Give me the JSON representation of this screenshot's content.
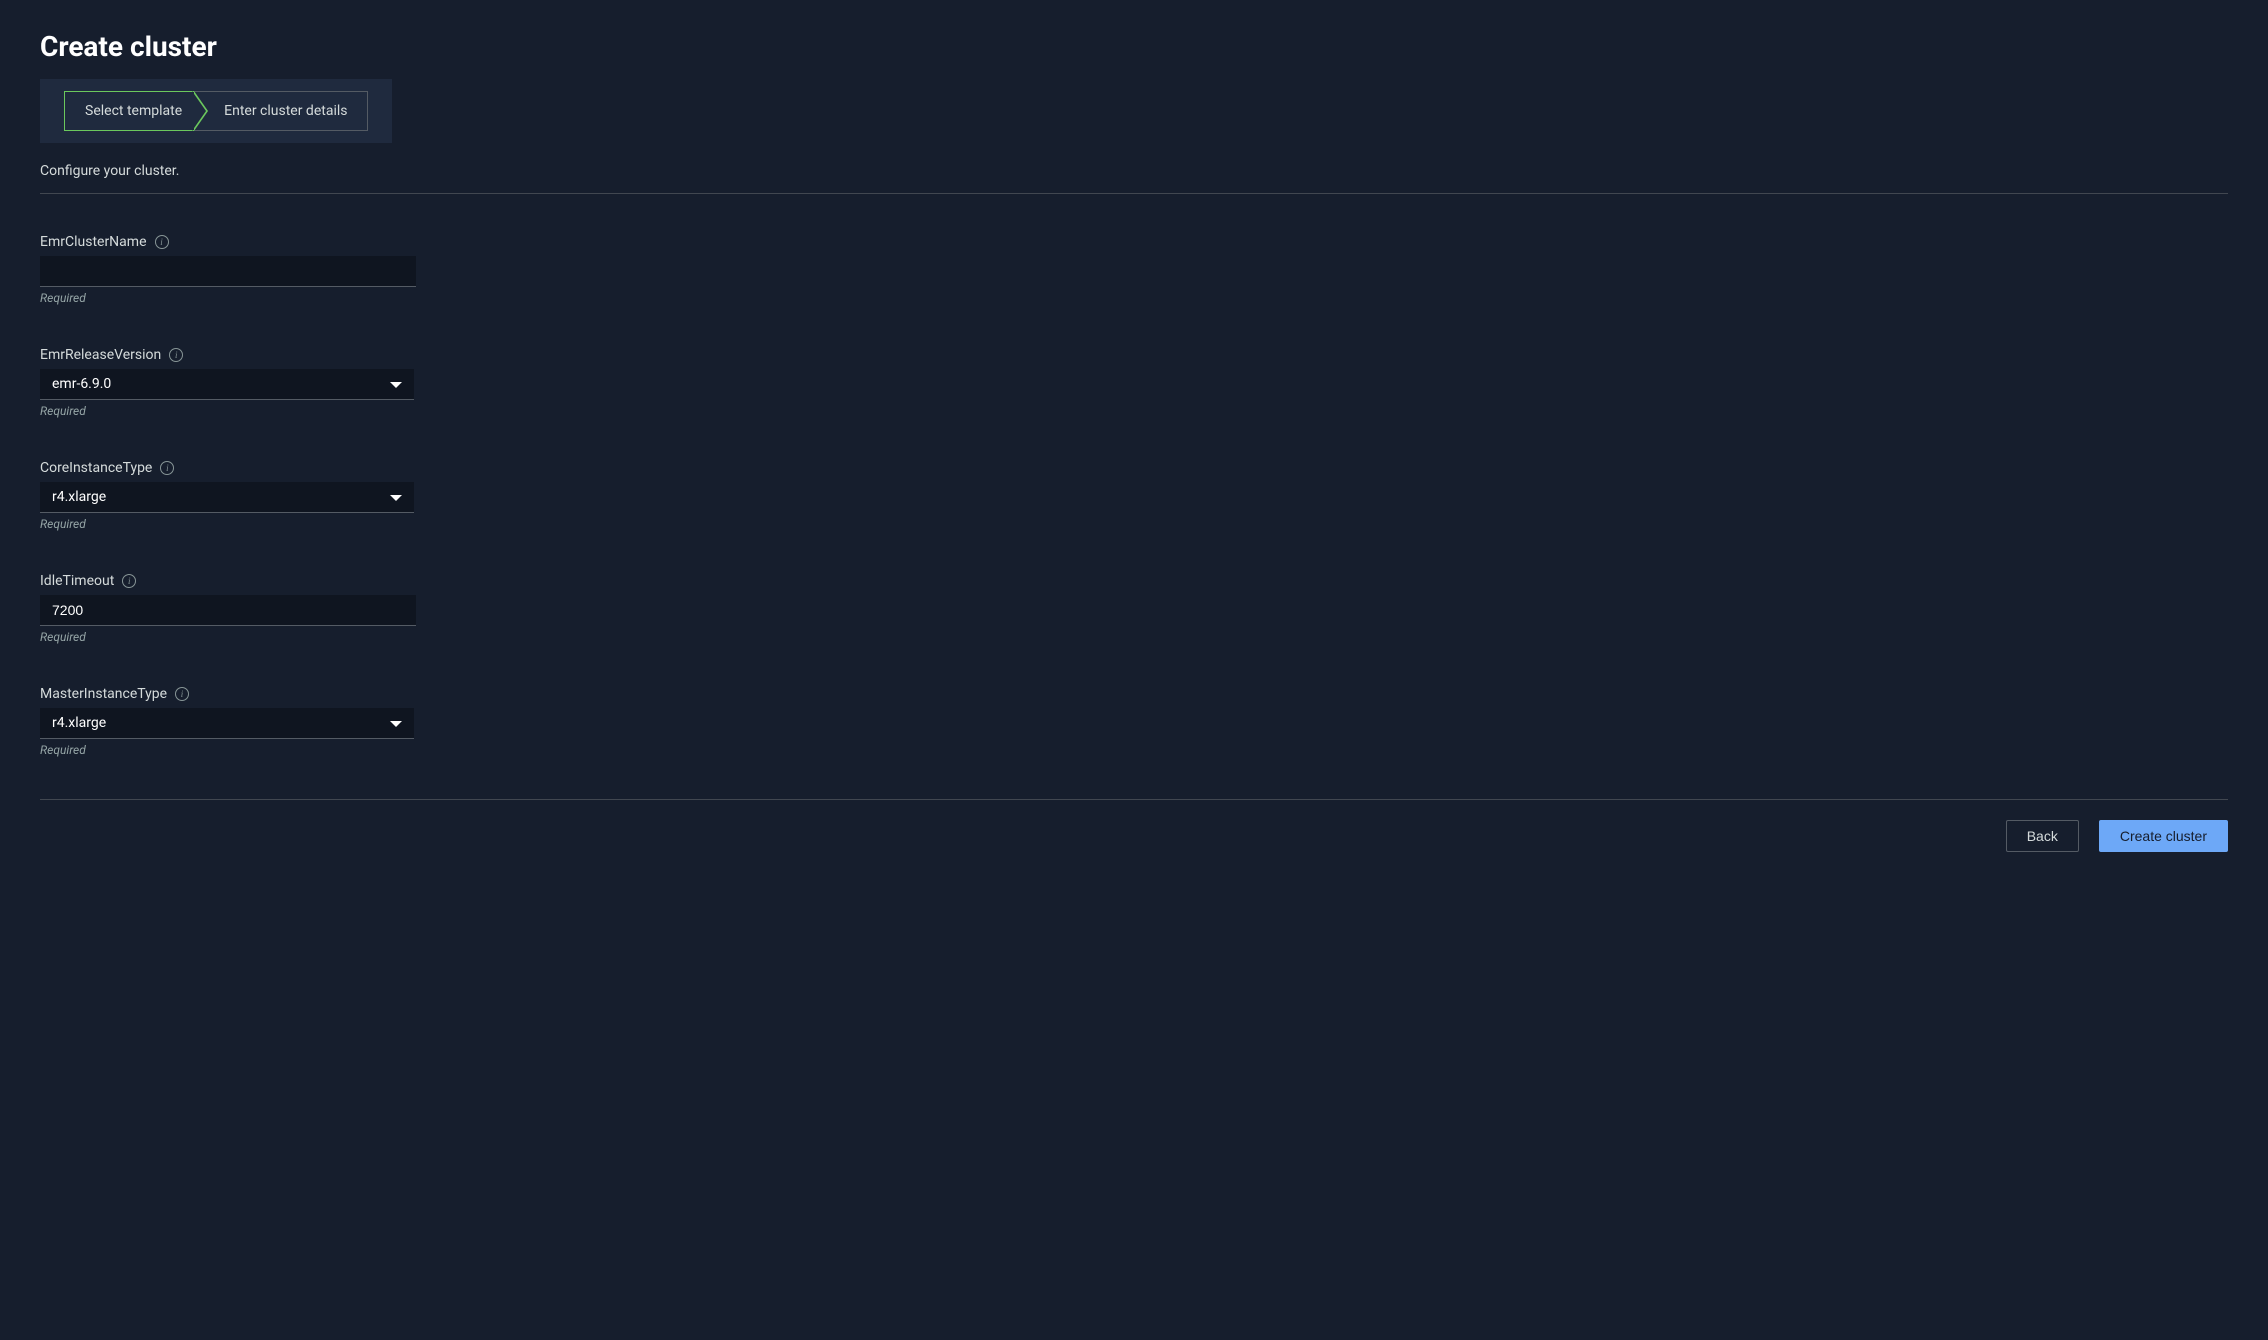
{
  "page": {
    "title": "Create cluster",
    "description": "Configure your cluster."
  },
  "steps": {
    "step1": "Select template",
    "step2": "Enter cluster details"
  },
  "fields": {
    "clusterName": {
      "label": "EmrClusterName",
      "value": "",
      "hint": "Required"
    },
    "releaseVersion": {
      "label": "EmrReleaseVersion",
      "value": "emr-6.9.0",
      "hint": "Required"
    },
    "coreInstanceType": {
      "label": "CoreInstanceType",
      "value": "r4.xlarge",
      "hint": "Required"
    },
    "idleTimeout": {
      "label": "IdleTimeout",
      "value": "7200",
      "hint": "Required"
    },
    "masterInstanceType": {
      "label": "MasterInstanceType",
      "value": "r4.xlarge",
      "hint": "Required"
    }
  },
  "buttons": {
    "back": "Back",
    "create": "Create cluster"
  }
}
